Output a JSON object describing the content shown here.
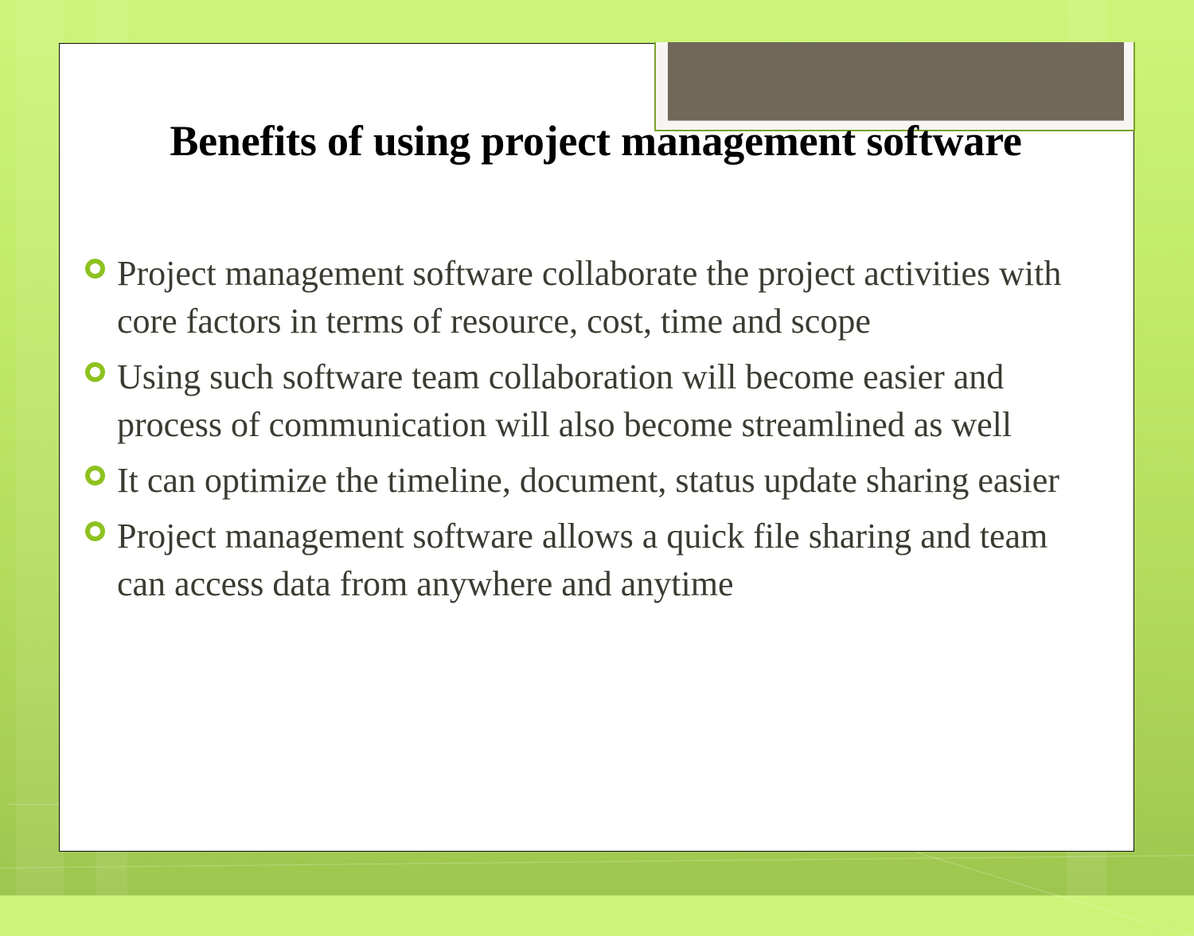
{
  "slide": {
    "title": "Benefits of using project management software",
    "bullets": [
      {
        "icon": "circle-bullet-icon",
        "text": "Project management software collaborate the project activities with core factors in terms of resource, cost, time and scope"
      },
      {
        "icon": "circle-bullet-icon",
        "text": "Using such software team collaboration will become easier and process of communication will also become streamlined as well"
      },
      {
        "icon": "circle-bullet-icon",
        "text": "It can optimize the timeline, document, status update sharing easier"
      },
      {
        "icon": "circle-bullet-icon",
        "text": "Project management software allows a quick file sharing and team can access data from anywhere and anytime"
      }
    ]
  },
  "colors": {
    "accent": "#8dc21f",
    "body_text": "#3b3b32",
    "title_text": "#000000",
    "placeholder_fill": "#706859",
    "background": "#b3dc5c"
  }
}
